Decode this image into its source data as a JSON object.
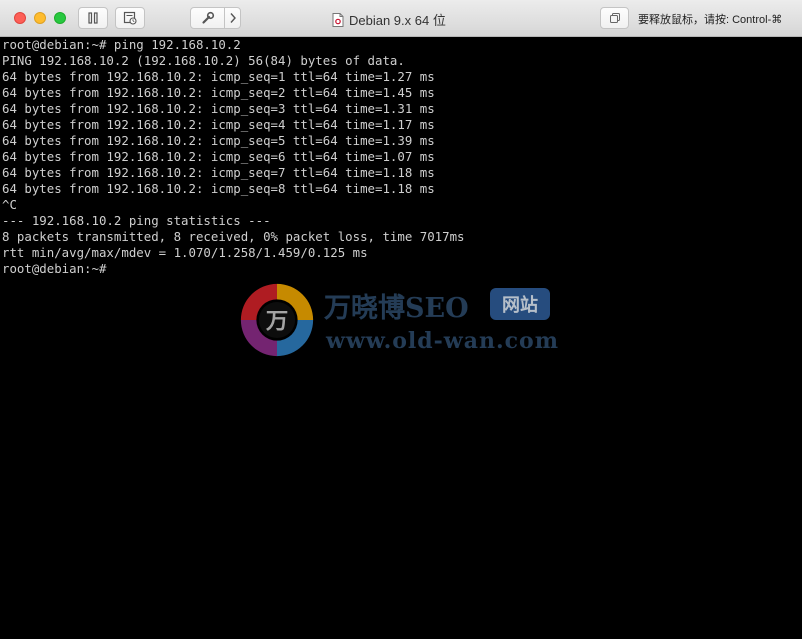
{
  "window": {
    "title": "Debian 9.x 64 位",
    "release_hint": "要释放鼠标，请按: Control-⌘"
  },
  "toolbar": {
    "buttons": [
      {
        "name": "pause-button",
        "icon": "pause-icon"
      },
      {
        "name": "snapshot-button",
        "icon": "snapshot-icon"
      },
      {
        "name": "settings-button",
        "icon": "wrench-icon"
      },
      {
        "name": "expand-button",
        "icon": "chevron-right-icon"
      }
    ],
    "right_button_icon": "windows-stack-icon"
  },
  "terminal": {
    "lines": [
      "root@debian:~# ping 192.168.10.2",
      "PING 192.168.10.2 (192.168.10.2) 56(84) bytes of data.",
      "64 bytes from 192.168.10.2: icmp_seq=1 ttl=64 time=1.27 ms",
      "64 bytes from 192.168.10.2: icmp_seq=2 ttl=64 time=1.45 ms",
      "64 bytes from 192.168.10.2: icmp_seq=3 ttl=64 time=1.31 ms",
      "64 bytes from 192.168.10.2: icmp_seq=4 ttl=64 time=1.17 ms",
      "64 bytes from 192.168.10.2: icmp_seq=5 ttl=64 time=1.39 ms",
      "64 bytes from 192.168.10.2: icmp_seq=6 ttl=64 time=1.07 ms",
      "64 bytes from 192.168.10.2: icmp_seq=7 ttl=64 time=1.18 ms",
      "64 bytes from 192.168.10.2: icmp_seq=8 ttl=64 time=1.18 ms",
      "^C",
      "--- 192.168.10.2 ping statistics ---",
      "8 packets transmitted, 8 received, 0% packet loss, time 7017ms",
      "rtt min/avg/max/mdev = 1.070/1.258/1.459/0.125 ms",
      "root@debian:~#"
    ]
  },
  "watermark": {
    "logo_char": "万",
    "brand": "万晓博SEO",
    "tag": "网站",
    "url": "www.old-wan.com"
  },
  "colors": {
    "terminal_bg": "#000000",
    "terminal_fg": "#cfcfcf",
    "titlebar_bg": "#e3e3e3",
    "close": "#fd5f57",
    "minimize": "#febc2e",
    "maximize": "#28c840"
  }
}
